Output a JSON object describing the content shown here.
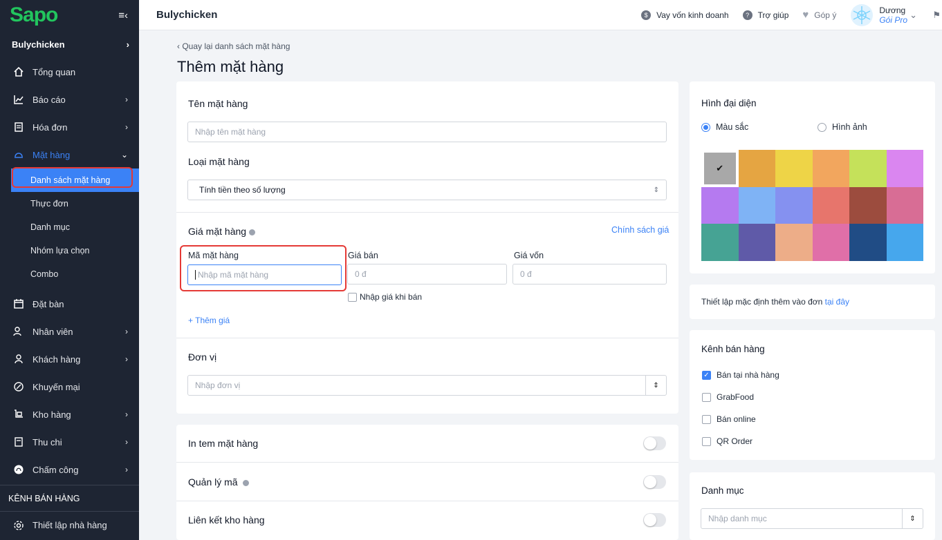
{
  "sidebar": {
    "logo": "Sapo",
    "shop": "Bulychicken",
    "items": [
      {
        "label": "Tổng quan",
        "icon": "home-icon"
      },
      {
        "label": "Báo cáo",
        "icon": "chart-icon"
      },
      {
        "label": "Hóa đơn",
        "icon": "invoice-icon"
      },
      {
        "label": "Mặt hàng",
        "icon": "dish-icon"
      }
    ],
    "sub": [
      "Danh sách mặt hàng",
      "Thực đơn",
      "Danh mục",
      "Nhóm lựa chọn",
      "Combo"
    ],
    "items2": [
      {
        "label": "Đặt bàn",
        "icon": "calendar-icon"
      },
      {
        "label": "Nhân viên",
        "icon": "staff-icon"
      },
      {
        "label": "Khách hàng",
        "icon": "customer-icon"
      },
      {
        "label": "Khuyến mại",
        "icon": "promo-icon"
      },
      {
        "label": "Kho hàng",
        "icon": "warehouse-icon"
      },
      {
        "label": "Thu chi",
        "icon": "cashbook-icon"
      },
      {
        "label": "Chấm công",
        "icon": "fingerprint-icon"
      }
    ],
    "section": "KÊNH BÁN HÀNG",
    "settings": "Thiết lập nhà hàng"
  },
  "topbar": {
    "title": "Bulychicken",
    "loan": "Vay vốn kinh doanh",
    "help": "Trợ giúp",
    "feedback": "Góp ý",
    "user_name": "Dương",
    "user_plan": "Gói Pro"
  },
  "page": {
    "back": "Quay lại danh sách mặt hàng",
    "title": "Thêm mặt hàng"
  },
  "form": {
    "name_label": "Tên mặt hàng",
    "name_placeholder": "Nhập tên mặt hàng",
    "type_label": "Loại mặt hàng",
    "type_value": "Tính tiền theo số lượng",
    "price_label": "Giá mặt hàng",
    "price_policy": "Chính sách giá",
    "code_label": "Mã mặt hàng",
    "code_placeholder": "Nhập mã mặt hàng",
    "sell_label": "Giá bán",
    "sell_placeholder": "0 đ",
    "cost_label": "Giá vốn",
    "cost_placeholder": "0 đ",
    "price_on_sale": "Nhập giá khi bán",
    "add_price": "+ Thêm giá",
    "unit_label": "Đơn vị",
    "unit_placeholder": "Nhập đơn vị",
    "print_label": "In tem mặt hàng",
    "code_manage": "Quản lý mã",
    "stock_link": "Liên kết kho hàng"
  },
  "right": {
    "avatar_title": "Hình đại diện",
    "opt_color": "Màu sắc",
    "opt_image": "Hình ảnh",
    "colors": [
      "#a8a8a8",
      "#e5a542",
      "#eed447",
      "#f2a65e",
      "#c5e15a",
      "#da86f0",
      "#b57af0",
      "#7fb3f5",
      "#8591f0",
      "#e7756c",
      "#9c4c3e",
      "#d86d95",
      "#46a394",
      "#5f5aa8",
      "#edad88",
      "#e06fa8",
      "#204c85",
      "#46a7ed"
    ],
    "default_text": "Thiết lập mặc định thêm vào đơn",
    "default_link": "tại đây",
    "channels_title": "Kênh bán hàng",
    "channels": [
      {
        "label": "Bán tại nhà hàng",
        "checked": true
      },
      {
        "label": "GrabFood",
        "checked": false
      },
      {
        "label": "Bán online",
        "checked": false
      },
      {
        "label": "QR Order",
        "checked": false
      }
    ],
    "category_title": "Danh mục",
    "category_placeholder": "Nhập danh mục"
  }
}
